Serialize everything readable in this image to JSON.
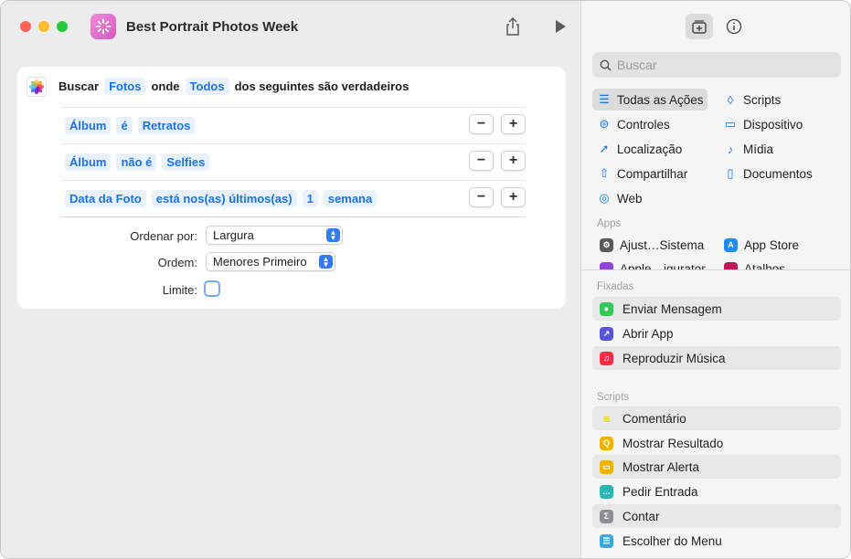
{
  "window": {
    "title": "Best Portrait Photos Week"
  },
  "action": {
    "verb": "Buscar",
    "object": "Fotos",
    "where": "onde",
    "quantifier": "Todos",
    "suffix": "dos seguintes são verdadeiros",
    "conditions": [
      {
        "field": "Álbum",
        "op": "é",
        "value": "Retratos"
      },
      {
        "field": "Álbum",
        "op": "não é",
        "value": "Selfies"
      },
      {
        "field": "Data da Foto",
        "op": "está nos(as) últimos(as)",
        "value": "1",
        "unit": "semana"
      }
    ],
    "sort_label": "Ordenar por:",
    "sort_value": "Largura",
    "order_label": "Ordem:",
    "order_value": "Menores Primeiro",
    "limit_label": "Limite:"
  },
  "sidebar": {
    "search_placeholder": "Buscar",
    "categories": [
      {
        "label": "Todas as Ações",
        "icon": "list-icon"
      },
      {
        "label": "Scripts",
        "icon": "scripts-icon"
      },
      {
        "label": "Controles",
        "icon": "toggle-icon"
      },
      {
        "label": "Dispositivo",
        "icon": "display-icon"
      },
      {
        "label": "Localização",
        "icon": "location-arrow-icon"
      },
      {
        "label": "Mídia",
        "icon": "music-note-icon"
      },
      {
        "label": "Compartilhar",
        "icon": "share-icon"
      },
      {
        "label": "Documentos",
        "icon": "document-icon"
      },
      {
        "label": "Web",
        "icon": "compass-icon"
      }
    ],
    "apps_header": "Apps",
    "apps": [
      {
        "label": "Ajust…Sistema"
      },
      {
        "label": "App Store"
      },
      {
        "label": "Apple…igurator"
      },
      {
        "label": "Atalhos"
      }
    ],
    "pinned_header": "Fixadas",
    "pinned": [
      {
        "label": "Enviar Mensagem",
        "color": "#34c759"
      },
      {
        "label": "Abrir App",
        "color": "#5856d6"
      },
      {
        "label": "Reproduzir Música",
        "color": "#fa2d48"
      }
    ],
    "scripts_header": "Scripts",
    "scripts": [
      {
        "label": "Comentário",
        "color": "#f5c518"
      },
      {
        "label": "Mostrar Resultado",
        "color": "#f0b400"
      },
      {
        "label": "Mostrar Alerta",
        "color": "#f0b400"
      },
      {
        "label": "Pedir Entrada",
        "color": "#2bb5b5"
      },
      {
        "label": "Contar",
        "color": "#8e8e93"
      },
      {
        "label": "Escolher do Menu",
        "color": "#38a9e0"
      }
    ]
  }
}
